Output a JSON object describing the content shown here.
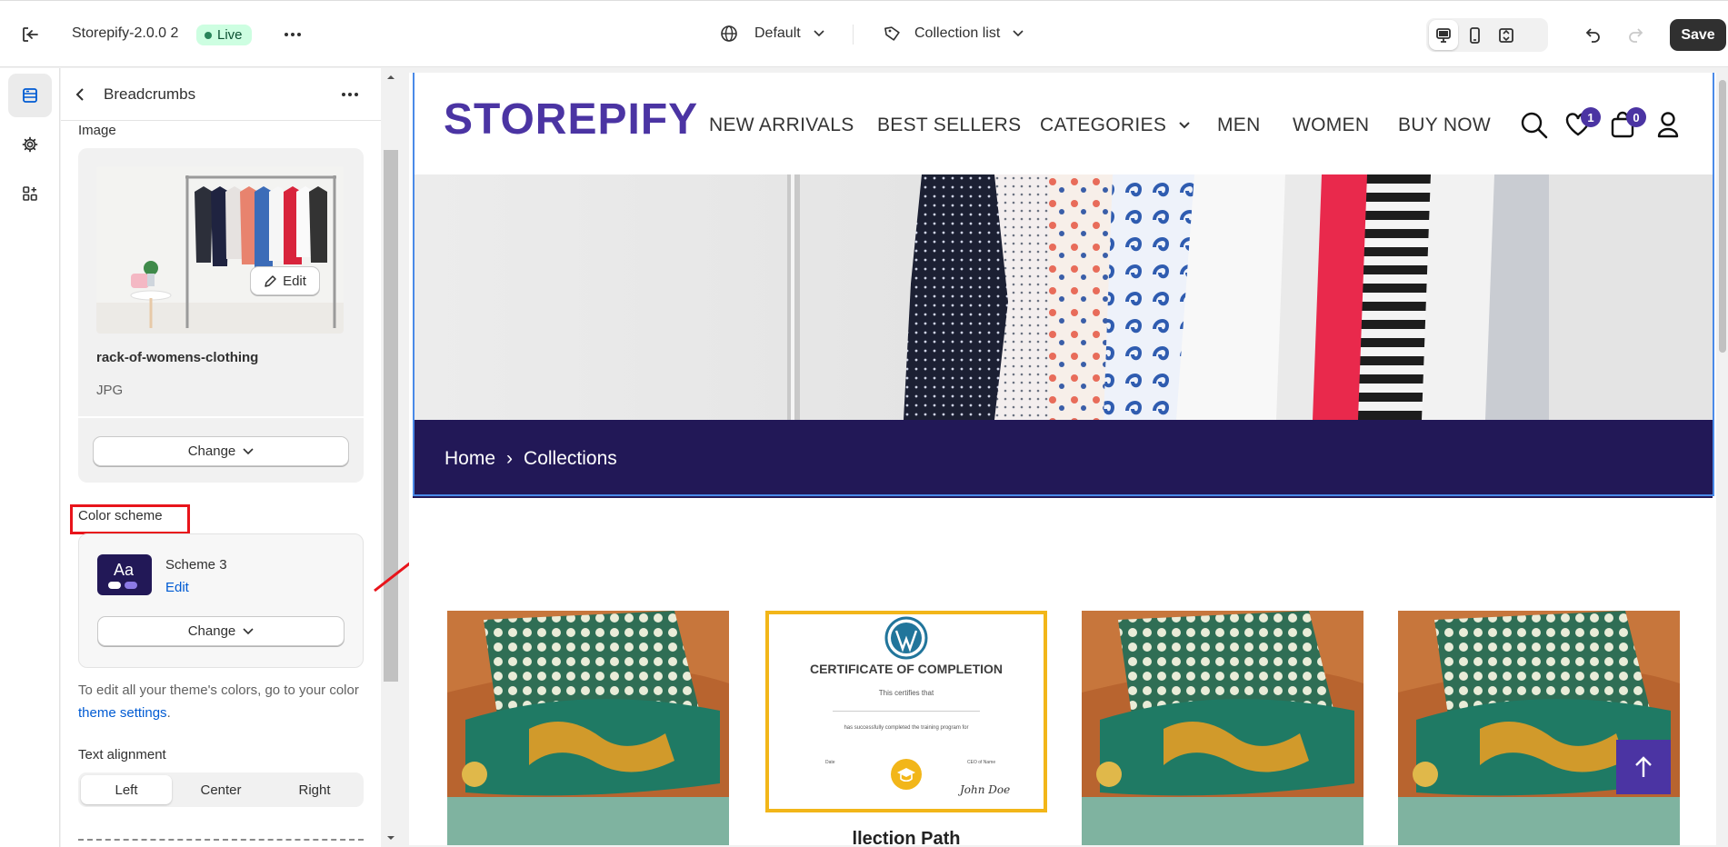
{
  "topbar": {
    "store_name": "Storepify-2.0.0 2",
    "status": "Live",
    "device_select": "Default",
    "template_select": "Collection list",
    "save_label": "Save"
  },
  "panel": {
    "title": "Breadcrumbs",
    "image_label": "Image",
    "image_edit": "Edit",
    "image_name": "rack-of-womens-clothing",
    "image_type": "JPG",
    "change_label": "Change",
    "color_scheme_label": "Color scheme",
    "scheme_swatch": "Aa",
    "scheme_name": "Scheme 3",
    "scheme_edit": "Edit",
    "scheme_change": "Change",
    "help_text": "To edit all your theme's colors, go to your color ",
    "help_link": "theme settings",
    "help_end": ".",
    "text_alignment_label": "Text alignment",
    "alignment_options": [
      "Left",
      "Center",
      "Right"
    ],
    "alignment_selected": "Left"
  },
  "preview": {
    "logo": "STOREPIFY",
    "menu": [
      "NEW ARRIVALS",
      "BEST SELLERS",
      "CATEGORIES",
      "MEN",
      "WOMEN",
      "BUY NOW"
    ],
    "wishlist_count": "1",
    "cart_count": "0",
    "breadcrumb_home": "Home",
    "breadcrumb_sep": "›",
    "breadcrumb_current": "Collections",
    "certificate_title": "CERTIFICATE OF COMPLETION",
    "certificate_line1": "This certifies that",
    "certificate_line2": "has successfully completed the training program for",
    "certificate_date": "Date",
    "certificate_role": "CEO of Name",
    "certificate_sign": "John Doe",
    "product_title_partial": "llection Path"
  },
  "colors": {
    "brand_purple": "#4b34a3",
    "crumb_bar": "#221857",
    "highlight_red": "#e8141b",
    "selection_blue": "#4a8ae8"
  }
}
